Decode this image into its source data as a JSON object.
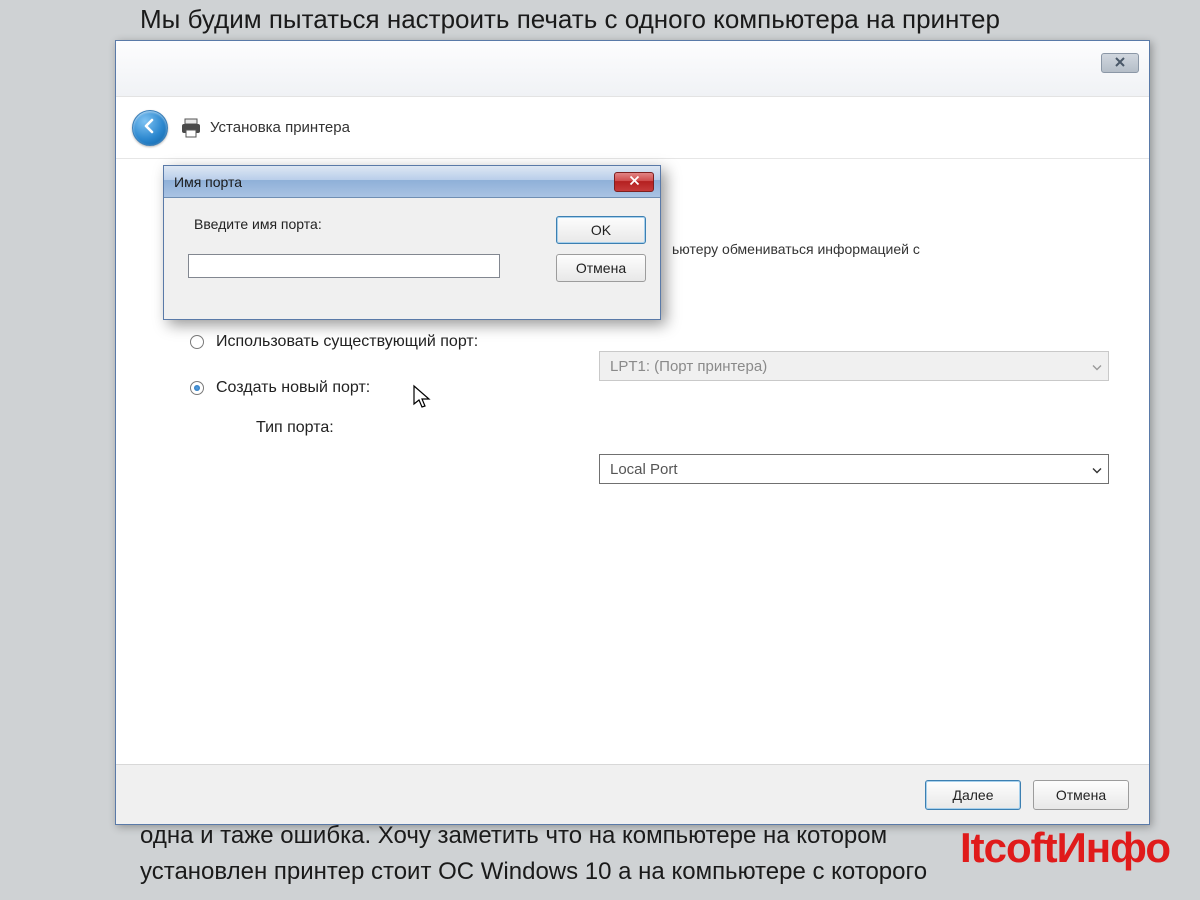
{
  "background": {
    "top_line": "Мы будим пытаться настроить печать с одного компьютера на принтер",
    "bottom_line1": "одна и таже ошибка. Хочу заметить что на компьютере на котором",
    "bottom_line2": "установлен принтер стоит ОС Windows 10 а на компьютере с которого"
  },
  "watermark": "ItсoftИнфо",
  "wizard": {
    "title": "Установка принтера",
    "description_partial": "ьютеру обмениваться информацией с",
    "radio_existing_label": "Использовать существующий порт:",
    "radio_new_label": "Создать новый порт:",
    "port_type_label": "Тип порта:",
    "existing_port_value": "LPT1: (Порт принтера)",
    "port_type_value": "Local Port",
    "next_button": "Далее",
    "cancel_button": "Отмена"
  },
  "modal": {
    "title": "Имя порта",
    "label": "Введите имя порта:",
    "input_value": "",
    "ok_button": "OK",
    "cancel_button": "Отмена"
  }
}
